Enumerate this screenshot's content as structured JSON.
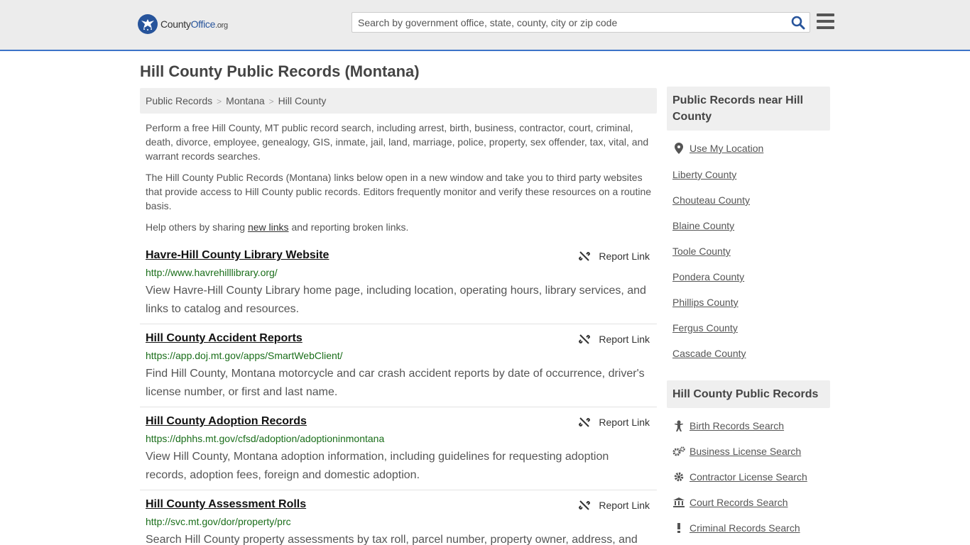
{
  "header": {
    "logo_county": "County",
    "logo_office": "Office",
    "logo_tld": ".org",
    "search_placeholder": "Search by government office, state, county, city or zip code",
    "search_icon": "search-icon",
    "menu_icon": "hamburger-menu-icon",
    "accent_color": "#3c73c8"
  },
  "page_title": "Hill County Public Records (Montana)",
  "breadcrumb": [
    "Public Records",
    "Montana",
    "Hill County"
  ],
  "intro": {
    "p1": "Perform a free Hill County, MT public record search, including arrest, birth, business, contractor, court, criminal, death, divorce, employee, genealogy, GIS, inmate, jail, land, marriage, police, property, sex offender, tax, vital, and warrant records searches.",
    "p2": "The Hill County Public Records (Montana) links below open in a new window and take you to third party websites that provide access to Hill County public records. Editors frequently monitor and verify these resources on a routine basis.",
    "p3_before": "Help others by sharing ",
    "p3_link": "new links",
    "p3_after": " and reporting broken links."
  },
  "report_label": "Report Link",
  "records": [
    {
      "title": "Havre-Hill County Library Website",
      "url": "http://www.havrehilllibrary.org/",
      "description": "View Havre-Hill County Library home page, including location, operating hours, library services, and links to catalog and resources."
    },
    {
      "title": "Hill County Accident Reports",
      "url": "https://app.doj.mt.gov/apps/SmartWebClient/",
      "description": "Find Hill County, Montana motorcycle and car crash accident reports by date of occurrence, driver's license number, or first and last name."
    },
    {
      "title": "Hill County Adoption Records",
      "url": "https://dphhs.mt.gov/cfsd/adoption/adoptioninmontana",
      "description": "View Hill County, Montana adoption information, including guidelines for requesting adoption records, adoption fees, foreign and domestic adoption."
    },
    {
      "title": "Hill County Assessment Rolls",
      "url": "http://svc.mt.gov/dor/property/prc",
      "description": "Search Hill County property assessments by tax roll, parcel number, property owner, address, and"
    }
  ],
  "sidebar": {
    "nearby_heading": "Public Records near Hill County",
    "use_location": "Use My Location",
    "nearby": [
      "Liberty County",
      "Chouteau County",
      "Blaine County",
      "Toole County",
      "Pondera County",
      "Phillips County",
      "Fergus County",
      "Cascade County"
    ],
    "records_heading": "Hill County Public Records",
    "record_links": [
      {
        "label": "Birth Records Search",
        "icon": "baby-icon"
      },
      {
        "label": "Business License Search",
        "icon": "gears-icon"
      },
      {
        "label": "Contractor License Search",
        "icon": "gear-icon"
      },
      {
        "label": "Court Records Search",
        "icon": "courthouse-icon"
      },
      {
        "label": "Criminal Records Search",
        "icon": "exclamation-icon"
      }
    ]
  }
}
